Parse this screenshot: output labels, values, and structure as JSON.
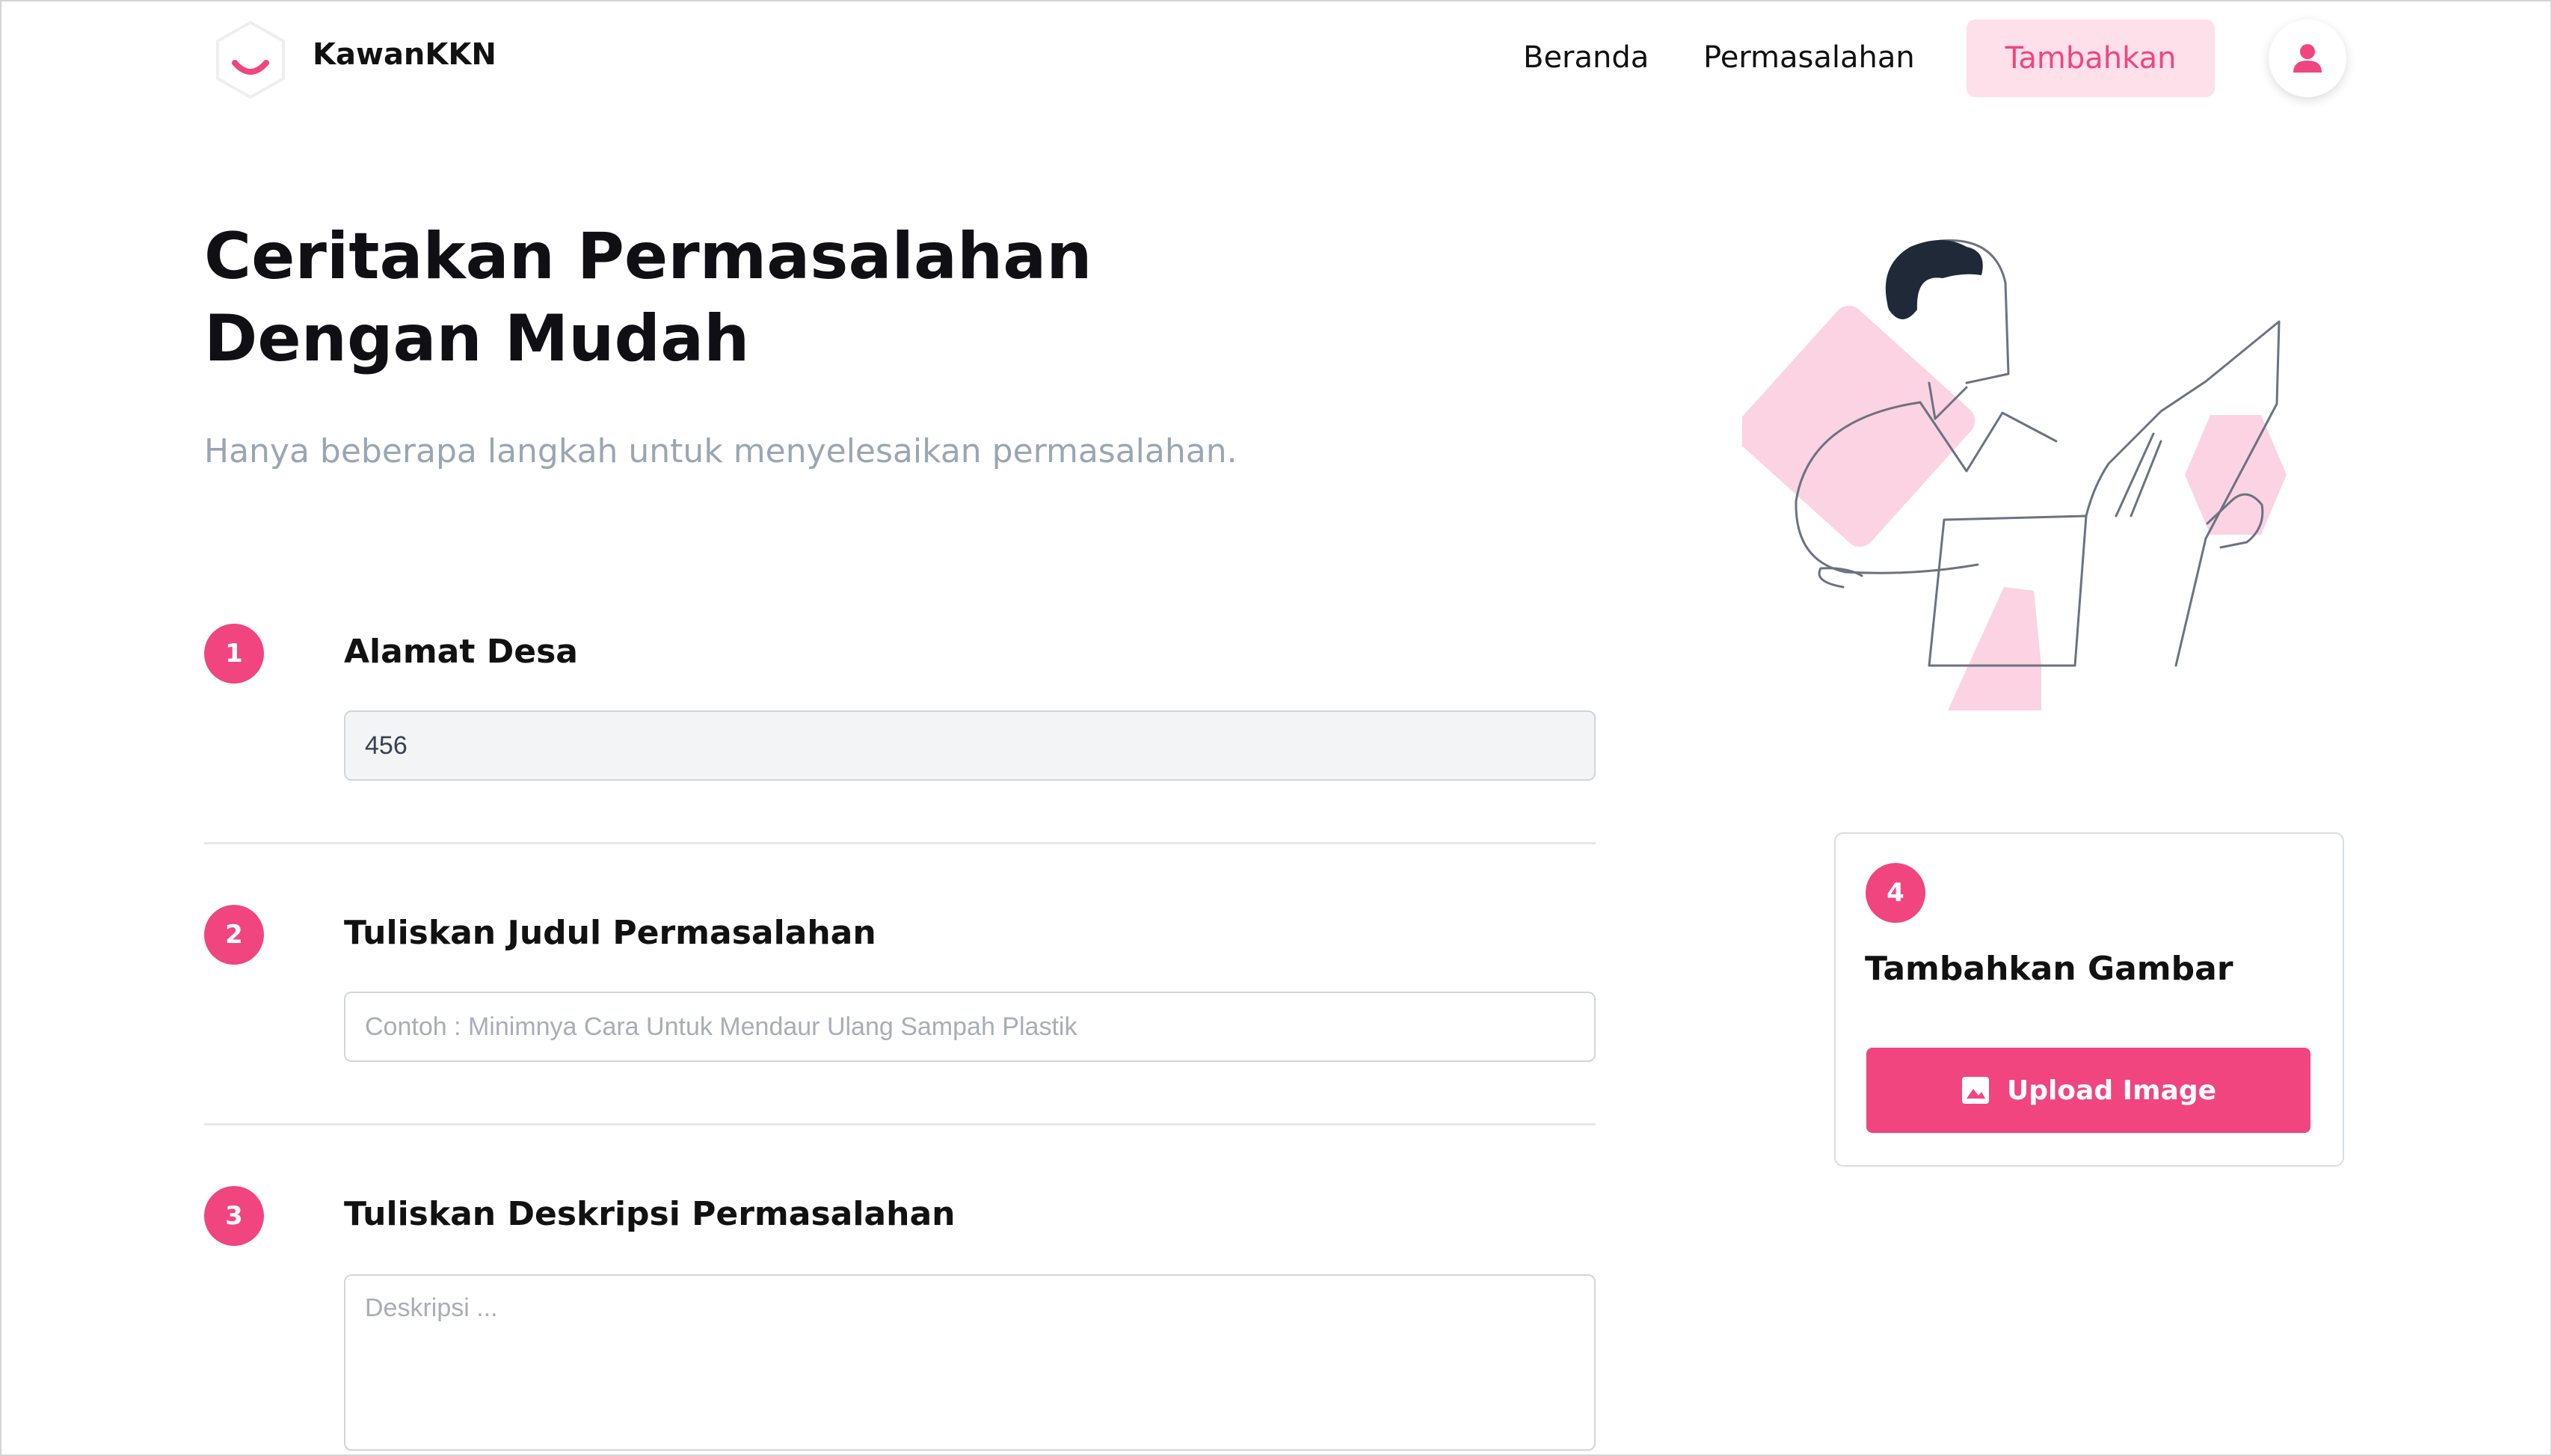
{
  "navbar": {
    "brand": "KawanKKN",
    "links": [
      "Beranda",
      "Permasalahan"
    ],
    "cta_label": "Tambahkan",
    "user_icon": "user-icon"
  },
  "hero": {
    "title": "Ceritakan Permasalahan Dengan Mudah",
    "subtitle": "Hanya beberapa langkah untuk menyelesaikan permasalahan."
  },
  "form": {
    "steps": [
      {
        "number": "1",
        "label": "Alamat Desa",
        "value": "456",
        "placeholder": ""
      },
      {
        "number": "2",
        "label": "Tuliskan Judul Permasalahan",
        "value": "",
        "placeholder": "Contoh : Minimnya Cara Untuk Mendaur Ulang Sampah Plastik"
      },
      {
        "number": "3",
        "label": "Tuliskan Deskripsi Permasalahan",
        "value": "",
        "placeholder": "Deskripsi ..."
      }
    ]
  },
  "upload": {
    "number": "4",
    "label": "Tambahkan Gambar",
    "button_label": "Upload Image",
    "button_icon": "image-icon"
  },
  "colors": {
    "accent": "#f0457e",
    "accent_light": "#fde0ea",
    "subtitle": "#9aa6b2",
    "border": "#d1d5db"
  }
}
